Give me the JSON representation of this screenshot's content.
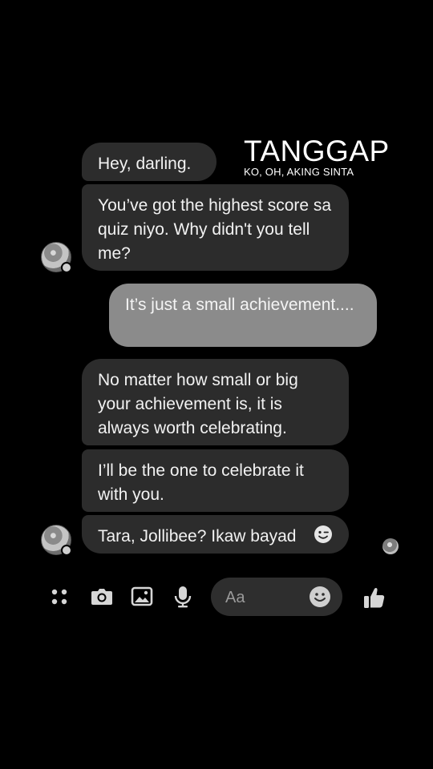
{
  "overlay": {
    "title": "TANGGAP",
    "subtitle": "KO, OH, AKING SINTA"
  },
  "messages": [
    {
      "from": "them",
      "text": "Hey, darling."
    },
    {
      "from": "them",
      "text": "You’ve got the highest score sa quiz niyo. Why didn't you tell me?"
    },
    {
      "from": "me",
      "text": "It’s just a small achievement...."
    },
    {
      "from": "them",
      "text": "No matter how small or big your achievement is, it is always worth celebrating."
    },
    {
      "from": "them",
      "text": "I’ll be the one to celebrate it with you."
    },
    {
      "from": "them",
      "text": "Tara, Jollibee? Ikaw bayad",
      "emoji": "winking-face"
    }
  ],
  "composer": {
    "placeholder": "Aa"
  },
  "icons": {
    "menu": "four-dots-icon",
    "camera": "camera-icon",
    "gallery": "image-icon",
    "voice": "microphone-icon",
    "emoji": "smiley-icon",
    "like": "thumbs-up-icon"
  },
  "colors": {
    "background": "#000000",
    "incoming_bubble": "#2c2c2c",
    "outgoing_bubble": "#8b8b8b"
  }
}
